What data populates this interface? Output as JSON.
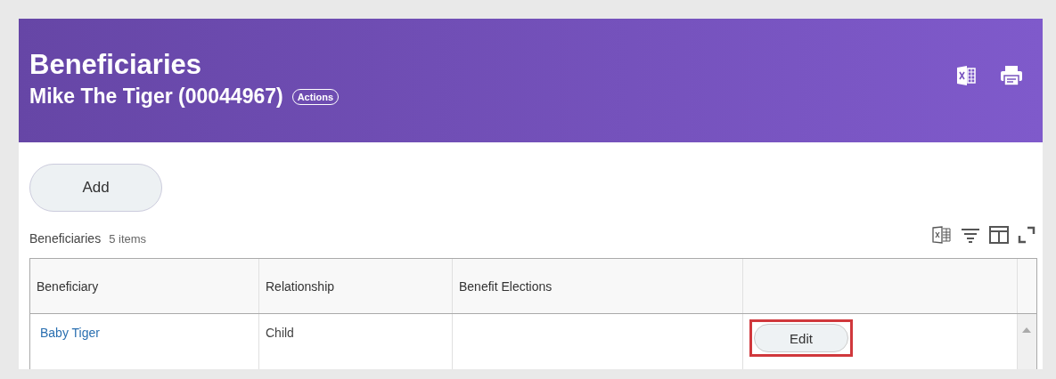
{
  "header": {
    "title": "Beneficiaries",
    "subtitle": "Mike The Tiger (00044967)",
    "actions_button": "Actions"
  },
  "add_button": "Add",
  "table": {
    "title": "Beneficiaries",
    "count": "5 items",
    "columns": [
      "Beneficiary",
      "Relationship",
      "Benefit Elections"
    ],
    "rows": [
      {
        "beneficiary": "Baby Tiger",
        "relationship": "Child",
        "button": "Edit",
        "highlighted": true
      }
    ]
  }
}
